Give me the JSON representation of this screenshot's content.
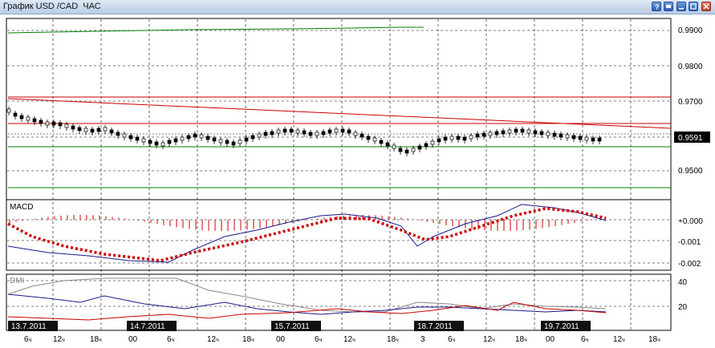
{
  "window": {
    "title": "График USD /CAD  ЧАС",
    "buttons": [
      {
        "name": "help-button",
        "icon": "help-icon"
      },
      {
        "name": "print-button",
        "icon": "print-icon"
      },
      {
        "name": "minimize-button",
        "icon": "minimize-icon"
      },
      {
        "name": "maximize-button",
        "icon": "maximize-icon"
      },
      {
        "name": "close-button",
        "icon": "close-icon"
      }
    ]
  },
  "price_panel": {
    "y_ticks": [
      "0.9900",
      "0.9800",
      "0.9700",
      "0.9591",
      "0.9500"
    ],
    "current_price": "0.9591"
  },
  "macd_panel": {
    "label": "MACD",
    "y_ticks": [
      "+0.000",
      "-0.001",
      "-0.002"
    ]
  },
  "dmi_panel": {
    "label": "DMI",
    "y_ticks": [
      "40",
      "20"
    ]
  },
  "time_axis": {
    "date_labels": [
      "13.7.2011",
      "14.7.2011",
      "15.7.2011",
      "18.7.2011",
      "19.7.2011"
    ],
    "hour_labels": [
      "6",
      "12",
      "18",
      "00",
      "6",
      "12",
      "18",
      "00",
      "6",
      "12",
      "18",
      "3",
      "6",
      "12",
      "18",
      "00",
      "6",
      "12",
      "18"
    ],
    "hour_suffix": "ч"
  },
  "colors": {
    "macd_line": "#1a1a8c",
    "signal_line": "#cc0000",
    "price_line": "#008000",
    "resistance": "#cc0000",
    "dmi_adx": "#888888",
    "dmi_plus": "#1a1a8c",
    "dmi_minus": "#cc0000"
  }
}
